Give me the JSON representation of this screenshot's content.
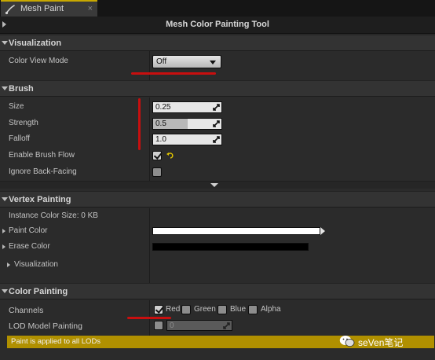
{
  "tab": {
    "label": "Mesh Paint",
    "close": "×"
  },
  "tool": {
    "title": "Mesh Color Painting Tool"
  },
  "visualization": {
    "header": "Visualization",
    "color_view_mode_label": "Color View Mode",
    "color_view_mode_value": "Off"
  },
  "brush": {
    "header": "Brush",
    "size_label": "Size",
    "size_value": "0.25",
    "strength_label": "Strength",
    "strength_value": "0.5",
    "strength_level": 0.5,
    "falloff_label": "Falloff",
    "falloff_value": "1.0",
    "flow_label": "Enable Brush Flow",
    "flow_checked": true,
    "backfacing_label": "Ignore Back-Facing",
    "backfacing_checked": false
  },
  "vertex": {
    "header": "Vertex Painting",
    "instance_size": "Instance Color Size: 0 KB",
    "paint_color_label": "Paint Color",
    "paint_color": "#ffffff",
    "erase_color_label": "Erase Color",
    "erase_color": "#000000",
    "visualization_label": "Visualization"
  },
  "color_painting": {
    "header": "Color Painting",
    "channels_label": "Channels",
    "channels": [
      {
        "label": "Red",
        "checked": true
      },
      {
        "label": "Green",
        "checked": false
      },
      {
        "label": "Blue",
        "checked": false
      },
      {
        "label": "Alpha",
        "checked": false
      }
    ],
    "lod_label": "LOD Model Painting",
    "lod_value": "0",
    "notice": "Paint is applied to all LODs"
  },
  "watermark": {
    "text": "seVen笔记"
  },
  "colors": {
    "accent": "#c8a800",
    "notice_bg": "#b09000",
    "annotation_red": "#c80f0f"
  }
}
